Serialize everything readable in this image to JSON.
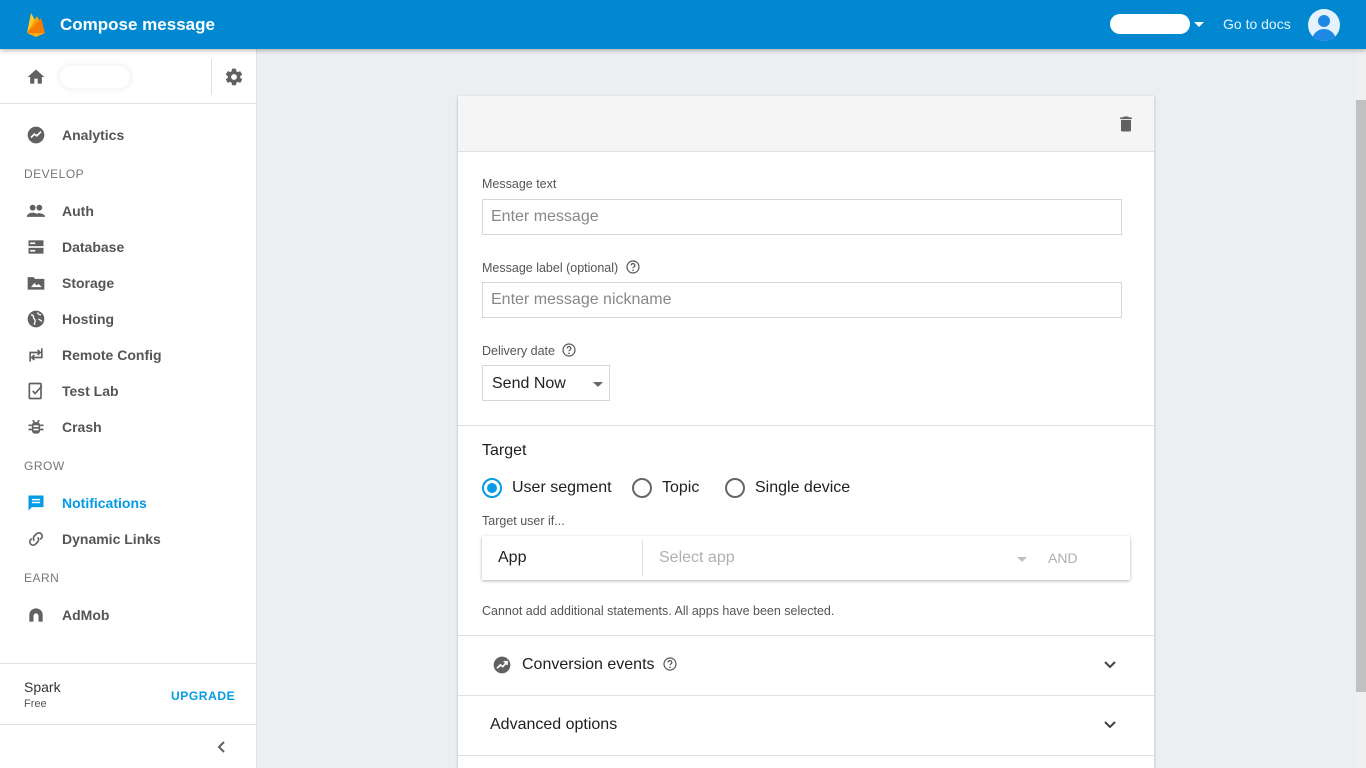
{
  "app": {
    "title": "Compose message",
    "docs_link": "Go to docs"
  },
  "sidebar": {
    "items": [
      {
        "label": "Analytics",
        "icon": "analytics-icon"
      },
      {
        "label": "Auth",
        "icon": "people-icon"
      },
      {
        "label": "Database",
        "icon": "database-icon"
      },
      {
        "label": "Storage",
        "icon": "storage-icon"
      },
      {
        "label": "Hosting",
        "icon": "globe-icon"
      },
      {
        "label": "Remote Config",
        "icon": "remote-config-icon"
      },
      {
        "label": "Test Lab",
        "icon": "test-lab-icon"
      },
      {
        "label": "Crash",
        "icon": "bug-icon"
      },
      {
        "label": "Notifications",
        "icon": "message-icon"
      },
      {
        "label": "Dynamic Links",
        "icon": "link-icon"
      },
      {
        "label": "AdMob",
        "icon": "admob-icon"
      }
    ],
    "sections": [
      "DEVELOP",
      "GROW",
      "EARN"
    ],
    "active": "Notifications",
    "plan": {
      "name": "Spark",
      "tier": "Free",
      "upgrade_label": "UPGRADE"
    }
  },
  "compose": {
    "message_text": {
      "label": "Message text",
      "placeholder": "Enter message"
    },
    "message_label": {
      "label": "Message label (optional)",
      "placeholder": "Enter message nickname"
    },
    "delivery": {
      "label": "Delivery date",
      "value": "Send Now"
    },
    "target": {
      "title": "Target",
      "options": [
        "User segment",
        "Topic",
        "Single device"
      ],
      "selected": "User segment",
      "hint": "Target user if...",
      "condition": {
        "field": "App",
        "placeholder": "Select app",
        "and_label": "AND"
      },
      "note": "Cannot add additional statements. All apps have been selected."
    },
    "conversion_events": "Conversion events",
    "advanced_options": "Advanced options"
  },
  "colors": {
    "topbar": "#0288d1",
    "accent": "#039be5",
    "background": "#eceff1"
  }
}
